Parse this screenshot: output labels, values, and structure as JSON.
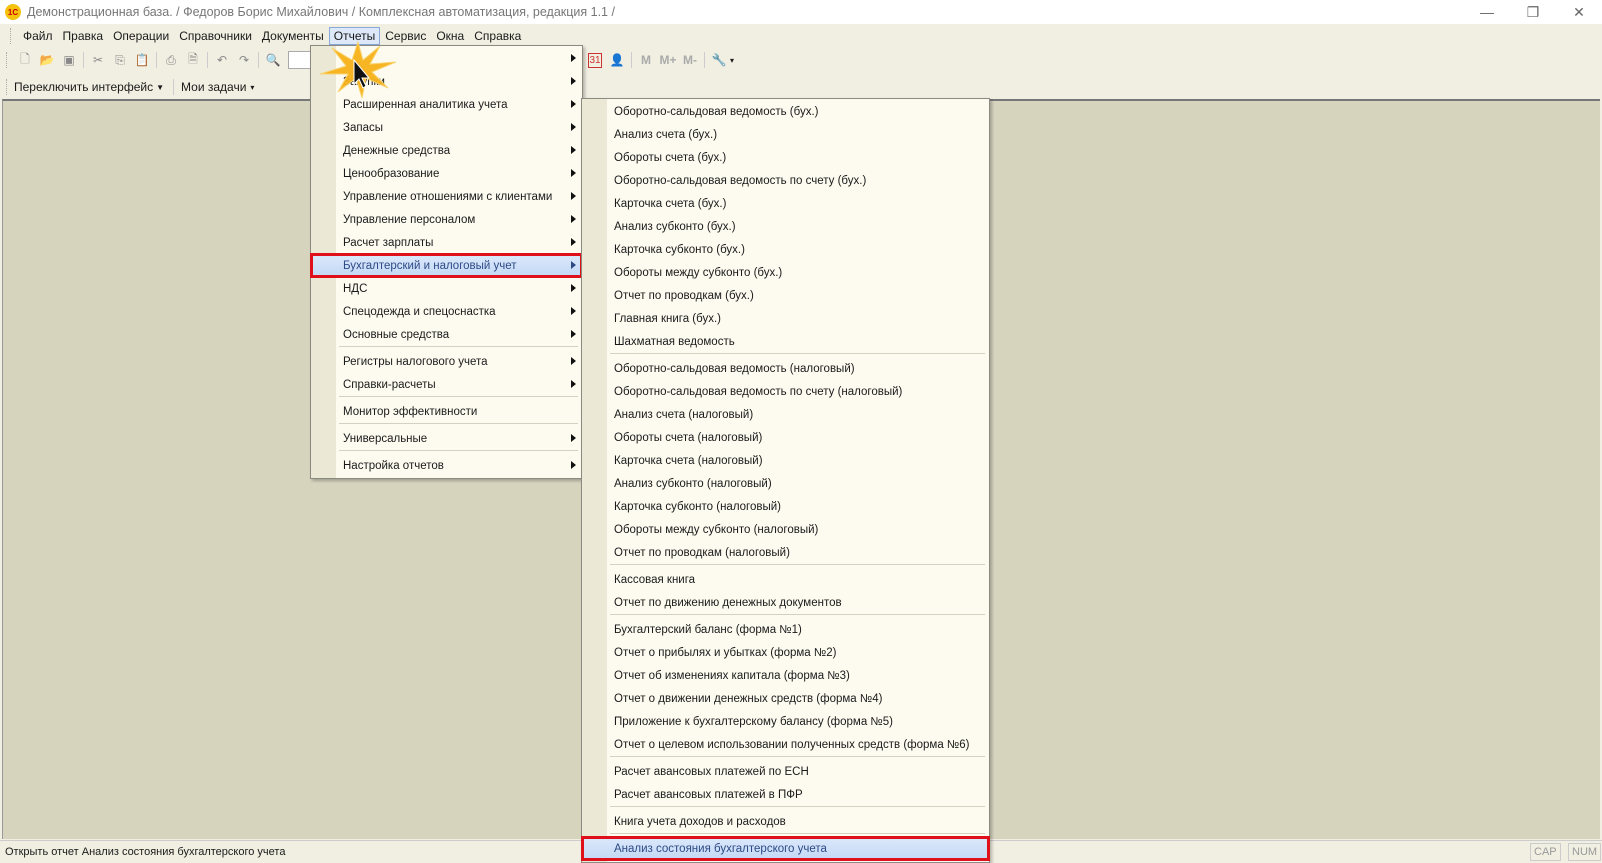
{
  "window": {
    "title": "Демонстрационная база. / Федоров Борис Михайлович /  Комплексная автоматизация, редакция 1.1 /",
    "logo": "1С"
  },
  "menubar": [
    "Файл",
    "Правка",
    "Операции",
    "Справочники",
    "Документы",
    "Отчеты",
    "Сервис",
    "Окна",
    "Справка"
  ],
  "toolbar2": {
    "switch_interface": "Переключить интерфейс",
    "my_tasks": "Мои задачи"
  },
  "toolbar_right": {
    "calendar": "31",
    "m": "M",
    "m_plus": "M+",
    "m_minus": "M-"
  },
  "reports_menu": [
    {
      "label": "",
      "submenu": true
    },
    {
      "label": "Закупки",
      "submenu": true
    },
    {
      "label": "Расширенная аналитика учета",
      "submenu": true
    },
    {
      "label": "Запасы",
      "submenu": true
    },
    {
      "label": "Денежные средства",
      "submenu": true
    },
    {
      "label": "Ценообразование",
      "submenu": true
    },
    {
      "label": "Управление отношениями с клиентами",
      "submenu": true
    },
    {
      "label": "Управление персоналом",
      "submenu": true
    },
    {
      "label": "Расчет зарплаты",
      "submenu": true
    },
    {
      "label": "Бухгалтерский и налоговый учет",
      "submenu": true,
      "highlighted": true
    },
    {
      "label": "НДС",
      "submenu": true
    },
    {
      "label": "Спецодежда и спецоснастка",
      "submenu": true
    },
    {
      "label": "Основные средства",
      "submenu": true
    },
    {
      "sep": true
    },
    {
      "label": "Регистры налогового учета",
      "submenu": true
    },
    {
      "label": "Справки-расчеты",
      "submenu": true
    },
    {
      "sep": true
    },
    {
      "label": "Монитор эффективности",
      "submenu": false
    },
    {
      "sep": true
    },
    {
      "label": "Универсальные",
      "submenu": true
    },
    {
      "sep": true
    },
    {
      "label": "Настройка отчетов",
      "submenu": true
    }
  ],
  "accounting_submenu": [
    {
      "label": "Оборотно-сальдовая ведомость (бух.)"
    },
    {
      "label": "Анализ счета (бух.)"
    },
    {
      "label": "Обороты счета (бух.)"
    },
    {
      "label": "Оборотно-сальдовая ведомость по счету (бух.)"
    },
    {
      "label": "Карточка счета (бух.)"
    },
    {
      "label": "Анализ субконто (бух.)"
    },
    {
      "label": "Карточка субконто (бух.)"
    },
    {
      "label": "Обороты между субконто (бух.)"
    },
    {
      "label": "Отчет по проводкам (бух.)"
    },
    {
      "label": "Главная книга (бух.)"
    },
    {
      "label": "Шахматная ведомость"
    },
    {
      "sep": true
    },
    {
      "label": "Оборотно-сальдовая ведомость (налоговый)"
    },
    {
      "label": "Оборотно-сальдовая ведомость по счету (налоговый)"
    },
    {
      "label": "Анализ счета (налоговый)"
    },
    {
      "label": "Обороты счета (налоговый)"
    },
    {
      "label": "Карточка счета (налоговый)"
    },
    {
      "label": "Анализ субконто (налоговый)"
    },
    {
      "label": "Карточка субконто (налоговый)"
    },
    {
      "label": "Обороты между субконто (налоговый)"
    },
    {
      "label": "Отчет по проводкам (налоговый)"
    },
    {
      "sep": true
    },
    {
      "label": "Кассовая книга"
    },
    {
      "label": "Отчет по движению денежных документов"
    },
    {
      "sep": true
    },
    {
      "label": "Бухгалтерский баланс (форма №1)"
    },
    {
      "label": "Отчет о прибылях и убытках  (форма №2)"
    },
    {
      "label": "Отчет об изменениях капитала  (форма №3)"
    },
    {
      "label": "Отчет о движении денежных средств (форма №4)"
    },
    {
      "label": "Приложение к бухгалтерскому балансу (форма №5)"
    },
    {
      "label": "Отчет о целевом использовании полученных средств (форма №6)"
    },
    {
      "sep": true
    },
    {
      "label": "Расчет авансовых платежей по ЕСН"
    },
    {
      "label": "Расчет авансовых платежей в ПФР"
    },
    {
      "sep": true
    },
    {
      "label": "Книга учета доходов и расходов"
    },
    {
      "sep": true
    },
    {
      "label": "Анализ состояния бухгалтерского учета",
      "highlighted": true
    }
  ],
  "statusbar": {
    "text": "Открыть отчет Анализ состояния бухгалтерского учета",
    "cap": "CAP",
    "num": "NUM"
  },
  "colors": {
    "highlight_border": "#e0101a",
    "highlight_bg": "#c3d8f5",
    "workspace": "#d7d4be"
  }
}
